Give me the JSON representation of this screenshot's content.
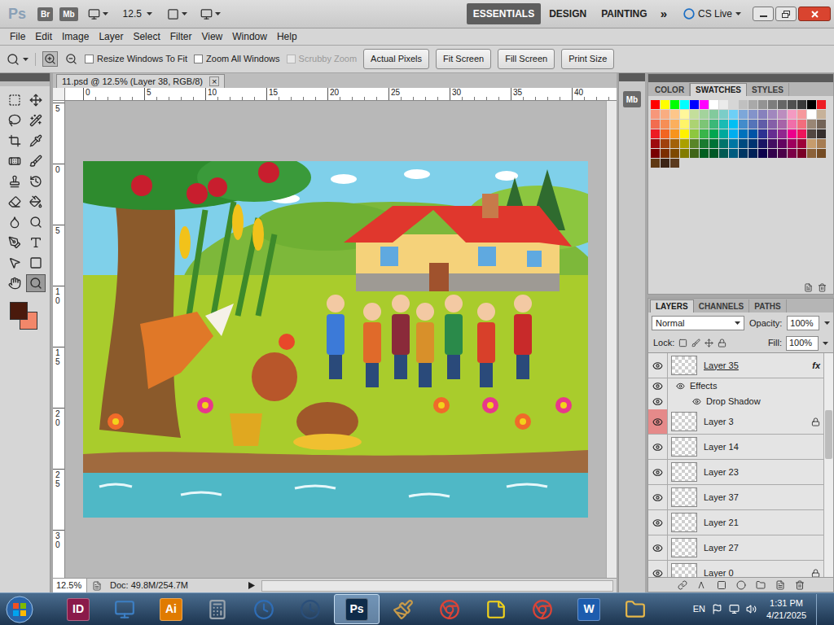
{
  "app_bar": {
    "logo": "Ps",
    "bridge": "Br",
    "mini_bridge": "Mb",
    "zoom": "12.5",
    "workspaces": [
      {
        "label": "ESSENTIALS",
        "selected": true
      },
      {
        "label": "DESIGN",
        "selected": false
      },
      {
        "label": "PAINTING",
        "selected": false
      }
    ],
    "more": "»",
    "cs_live": "CS Live"
  },
  "menu": [
    "File",
    "Edit",
    "Image",
    "Layer",
    "Select",
    "Filter",
    "View",
    "Window",
    "Help"
  ],
  "options_bar": {
    "checkboxes": [
      {
        "label": "Resize Windows To Fit",
        "checked": false,
        "disabled": false
      },
      {
        "label": "Zoom All Windows",
        "checked": false,
        "disabled": false
      },
      {
        "label": "Scrubby Zoom",
        "checked": false,
        "disabled": true
      }
    ],
    "buttons": [
      "Actual Pixels",
      "Fit Screen",
      "Fill Screen",
      "Print Size"
    ],
    "zoom_in_selected": true
  },
  "tools": [
    {
      "kind": "marquee",
      "selected": false
    },
    {
      "kind": "move",
      "selected": false
    },
    {
      "kind": "lasso",
      "selected": false
    },
    {
      "kind": "wand",
      "selected": false
    },
    {
      "kind": "crop",
      "selected": false
    },
    {
      "kind": "eyedropper",
      "selected": false
    },
    {
      "kind": "healing",
      "selected": false
    },
    {
      "kind": "brush",
      "selected": false
    },
    {
      "kind": "stamp",
      "selected": false
    },
    {
      "kind": "history",
      "selected": false
    },
    {
      "kind": "eraser",
      "selected": false
    },
    {
      "kind": "bucket",
      "selected": false
    },
    {
      "kind": "blur",
      "selected": false
    },
    {
      "kind": "dodge",
      "selected": false
    },
    {
      "kind": "pen",
      "selected": false
    },
    {
      "kind": "type",
      "selected": false
    },
    {
      "kind": "select",
      "selected": false
    },
    {
      "kind": "shape",
      "selected": false
    },
    {
      "kind": "hand",
      "selected": false
    },
    {
      "kind": "zoom",
      "selected": true
    }
  ],
  "colors": {
    "foreground": "#4a1a0c",
    "background": "#f2876a"
  },
  "document": {
    "tab_title": "11.psd @ 12.5% (Layer 38, RGB/8)",
    "close": "×",
    "ruler_top": [
      "0",
      "5",
      "10",
      "15",
      "20",
      "25",
      "30",
      "35",
      "40"
    ],
    "ruler_left": [
      "5",
      "0",
      "5",
      "10",
      "15",
      "20",
      "25",
      "30"
    ]
  },
  "status_bar": {
    "zoom": "12.5%",
    "doc": "Doc: 49.8M/254.7M"
  },
  "side_strip": {
    "label": "Mb"
  },
  "swatches_panel": {
    "tabs": [
      {
        "label": "COLOR",
        "selected": false
      },
      {
        "label": "SWATCHES",
        "selected": true
      },
      {
        "label": "STYLES",
        "selected": false
      }
    ],
    "swatches": [
      "#ff0000",
      "#ffff00",
      "#00ff00",
      "#00ffff",
      "#0000ff",
      "#ff00ff",
      "#ffffff",
      "#ebebeb",
      "#d6d6d6",
      "#c0c0c0",
      "#a9a9a9",
      "#939393",
      "#7d7d7d",
      "#666666",
      "#505050",
      "#393939",
      "#000000",
      "#ed1c24",
      "#f7977a",
      "#f9ad81",
      "#fdc68a",
      "#fff79a",
      "#c4df9b",
      "#a3d39c",
      "#82ca9d",
      "#7bcdc8",
      "#6dcff6",
      "#7da7d9",
      "#8393ca",
      "#8781bd",
      "#a187be",
      "#bc8dbf",
      "#f49ac2",
      "#f6989d",
      "#ffffff",
      "#c7b299",
      "#f26c4f",
      "#f68e55",
      "#fbaf5d",
      "#fff467",
      "#acd372",
      "#7cc576",
      "#3bb878",
      "#1abbb4",
      "#00bff3",
      "#438ccb",
      "#5574b9",
      "#605ca8",
      "#855fa8",
      "#a763a8",
      "#f06ea9",
      "#f26d7d",
      "#998675",
      "#736357",
      "#ed1c24",
      "#f26522",
      "#f7941d",
      "#fff200",
      "#8dc73f",
      "#39b54a",
      "#00a651",
      "#00a99d",
      "#00aeef",
      "#0072bc",
      "#0054a6",
      "#2e3192",
      "#662d91",
      "#92278f",
      "#ec008c",
      "#ed145b",
      "#534741",
      "#362f2d",
      "#9e0b0f",
      "#a0410d",
      "#a36209",
      "#aba000",
      "#598527",
      "#1a7b30",
      "#007236",
      "#00746b",
      "#0076a3",
      "#004b80",
      "#003471",
      "#1b1464",
      "#440e62",
      "#630460",
      "#9e005d",
      "#9e0039",
      "#c69c6d",
      "#a67c52",
      "#790000",
      "#7b2e00",
      "#7d4900",
      "#827b00",
      "#406618",
      "#005e20",
      "#005826",
      "#005952",
      "#005b7f",
      "#003663",
      "#002157",
      "#0d004c",
      "#32004b",
      "#4b0049",
      "#7b0046",
      "#7a0026",
      "#8c6239",
      "#754c24",
      "#603913",
      "#3c2415",
      "#5b3a1e"
    ]
  },
  "layers_panel": {
    "tabs": [
      {
        "label": "LAYERS",
        "selected": true
      },
      {
        "label": "CHANNELS",
        "selected": false
      },
      {
        "label": "PATHS",
        "selected": false
      }
    ],
    "blend_mode": "Normal",
    "opacity_label": "Opacity:",
    "opacity": "100%",
    "lock_label": "Lock:",
    "fill_label": "Fill:",
    "fill": "100%",
    "layers": [
      {
        "kind": "layer",
        "name": "Layer 35",
        "visible": true,
        "fx": "fx",
        "locked": false,
        "eye_highlighted": false
      },
      {
        "kind": "effects",
        "name": "Effects",
        "visible": true,
        "fx": "",
        "locked": false,
        "eye_highlighted": false
      },
      {
        "kind": "effect",
        "name": "Drop Shadow",
        "visible": true,
        "fx": "",
        "locked": false,
        "eye_highlighted": false
      },
      {
        "kind": "layer",
        "name": "Layer 3",
        "visible": true,
        "fx": "",
        "locked": true,
        "eye_highlighted": true
      },
      {
        "kind": "layer",
        "name": "Layer 14",
        "visible": true,
        "fx": "",
        "locked": false,
        "eye_highlighted": false
      },
      {
        "kind": "layer",
        "name": "Layer 23",
        "visible": true,
        "fx": "",
        "locked": false,
        "eye_highlighted": false
      },
      {
        "kind": "layer",
        "name": "Layer 37",
        "visible": true,
        "fx": "",
        "locked": false,
        "eye_highlighted": false
      },
      {
        "kind": "layer",
        "name": "Layer 21",
        "visible": true,
        "fx": "",
        "locked": false,
        "eye_highlighted": false
      },
      {
        "kind": "layer",
        "name": "Layer 27",
        "visible": true,
        "fx": "",
        "locked": false,
        "eye_highlighted": false
      },
      {
        "kind": "layer",
        "name": "Layer 0",
        "visible": true,
        "fx": "",
        "locked": true,
        "eye_highlighted": false
      }
    ]
  },
  "taskbar": {
    "apps": [
      {
        "kind": "glyph",
        "glyph": "ID",
        "color": "#8a1a4a",
        "selected": false
      },
      {
        "kind": "monitor",
        "glyph": "",
        "color": "#3d7fc4",
        "selected": false
      },
      {
        "kind": "glyph",
        "glyph": "Ai",
        "color": "#e07b00",
        "selected": false
      },
      {
        "kind": "calculator",
        "glyph": "",
        "color": "#9aa4ad",
        "selected": false
      },
      {
        "kind": "clock",
        "glyph": "",
        "color": "#2f6db5",
        "selected": false
      },
      {
        "kind": "clock",
        "glyph": "",
        "color": "#2b4f7a",
        "selected": false
      },
      {
        "kind": "glyph",
        "glyph": "Ps",
        "color": "#0f2c4a",
        "selected": true
      },
      {
        "kind": "paint",
        "glyph": "",
        "color": "#c89b4a",
        "selected": false
      },
      {
        "kind": "chrome",
        "glyph": "",
        "color": "#db4437",
        "selected": false
      },
      {
        "kind": "note",
        "glyph": "",
        "color": "#f2d21b",
        "selected": false
      },
      {
        "kind": "chrome",
        "glyph": "",
        "color": "#db4437",
        "selected": false
      },
      {
        "kind": "glyph",
        "glyph": "W",
        "color": "#1d5cae",
        "selected": false
      },
      {
        "kind": "folder",
        "glyph": "",
        "color": "#e8b84a",
        "selected": false
      }
    ],
    "language": "EN",
    "time": "1:31 PM",
    "date": "4/21/2025"
  }
}
